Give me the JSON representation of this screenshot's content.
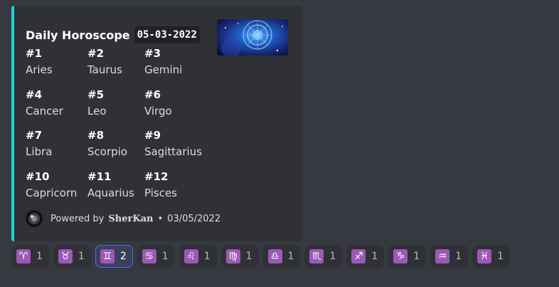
{
  "embed": {
    "title": "Daily Horoscope",
    "date_code": "05-03-2022",
    "accent_color": "#1fd6d6",
    "fields": [
      {
        "num": "#1",
        "name": "Aries"
      },
      {
        "num": "#2",
        "name": "Taurus"
      },
      {
        "num": "#3",
        "name": "Gemini"
      },
      {
        "num": "#4",
        "name": "Cancer"
      },
      {
        "num": "#5",
        "name": "Leo"
      },
      {
        "num": "#6",
        "name": "Virgo"
      },
      {
        "num": "#7",
        "name": "Libra"
      },
      {
        "num": "#8",
        "name": "Scorpio"
      },
      {
        "num": "#9",
        "name": "Sagittarius"
      },
      {
        "num": "#10",
        "name": "Capricorn"
      },
      {
        "num": "#11",
        "name": "Aquarius"
      },
      {
        "num": "#12",
        "name": "Pisces"
      }
    ],
    "footer": {
      "powered_by": "Powered by",
      "author": "SherKan",
      "separator": "•",
      "date": "03/05/2022"
    }
  },
  "reactions": [
    {
      "icon": "aries-icon",
      "glyph": "♈",
      "count": "1",
      "active": false
    },
    {
      "icon": "taurus-icon",
      "glyph": "♉",
      "count": "1",
      "active": false
    },
    {
      "icon": "gemini-icon",
      "glyph": "♊",
      "count": "2",
      "active": true
    },
    {
      "icon": "cancer-icon",
      "glyph": "♋",
      "count": "1",
      "active": false
    },
    {
      "icon": "leo-icon",
      "glyph": "♌",
      "count": "1",
      "active": false
    },
    {
      "icon": "virgo-icon",
      "glyph": "♍",
      "count": "1",
      "active": false
    },
    {
      "icon": "libra-icon",
      "glyph": "♎",
      "count": "1",
      "active": false
    },
    {
      "icon": "scorpio-icon",
      "glyph": "♏",
      "count": "1",
      "active": false
    },
    {
      "icon": "sagittarius-icon",
      "glyph": "♐",
      "count": "1",
      "active": false
    },
    {
      "icon": "capricorn-icon",
      "glyph": "♑",
      "count": "1",
      "active": false
    },
    {
      "icon": "aquarius-icon",
      "glyph": "♒",
      "count": "1",
      "active": false
    },
    {
      "icon": "pisces-icon",
      "glyph": "♓",
      "count": "1",
      "active": false
    }
  ]
}
